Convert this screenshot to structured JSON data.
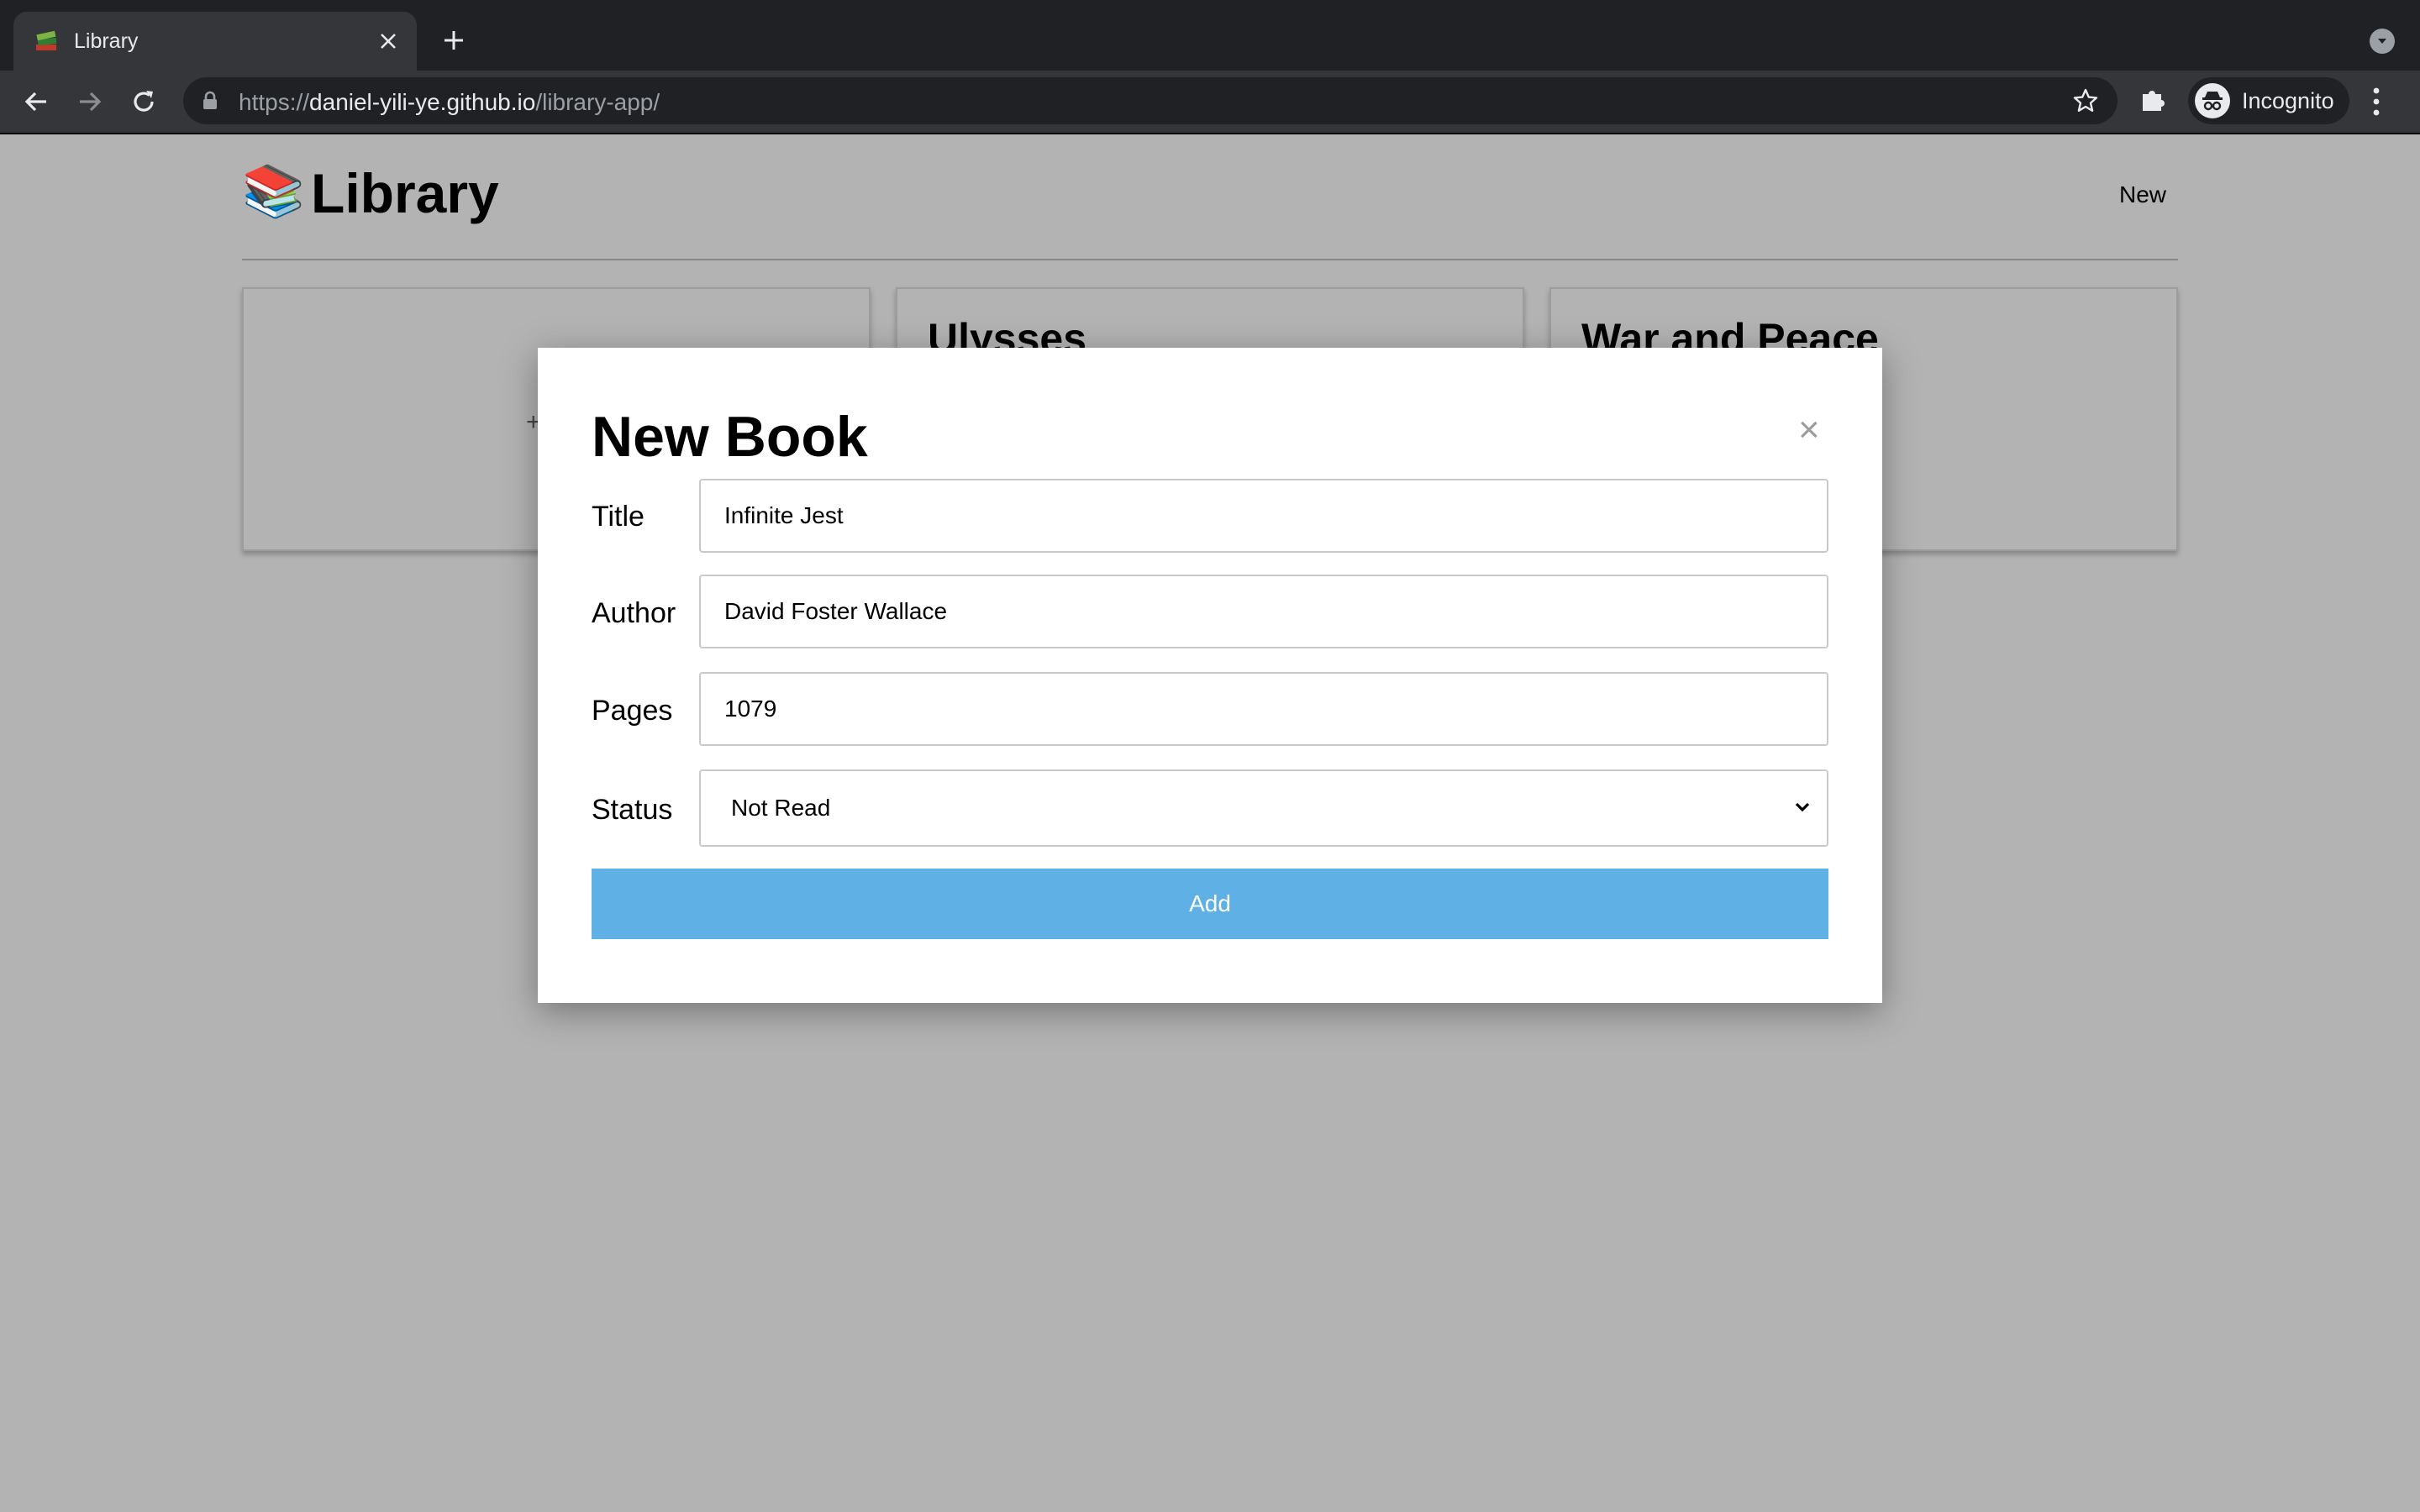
{
  "browser": {
    "tab": {
      "title": "Library",
      "favicon": "books-icon"
    },
    "url": {
      "scheme": "https://",
      "host": "daniel-yili-ye.github.io",
      "path": "/library-app/"
    },
    "profile_label": "Incognito"
  },
  "header": {
    "logo_emoji": "📚",
    "title": "Library",
    "new_label": "New"
  },
  "cards": [
    {
      "title": "",
      "add_symbol": "+"
    },
    {
      "title": "Ulysses"
    },
    {
      "title": "War and Peace"
    }
  ],
  "modal": {
    "title": "New Book",
    "close_symbol": "×",
    "fields": {
      "title": {
        "label": "Title",
        "value": "Infinite Jest"
      },
      "author": {
        "label": "Author",
        "value": "David Foster Wallace"
      },
      "pages": {
        "label": "Pages",
        "value": "1079"
      },
      "status": {
        "label": "Status",
        "value": "Not Read"
      }
    },
    "submit_label": "Add"
  },
  "colors": {
    "overlay_background": "#b3b3b3",
    "add_button": "#5eb0e5",
    "chrome_dark": "#202124",
    "chrome_toolbar": "#35363a"
  }
}
